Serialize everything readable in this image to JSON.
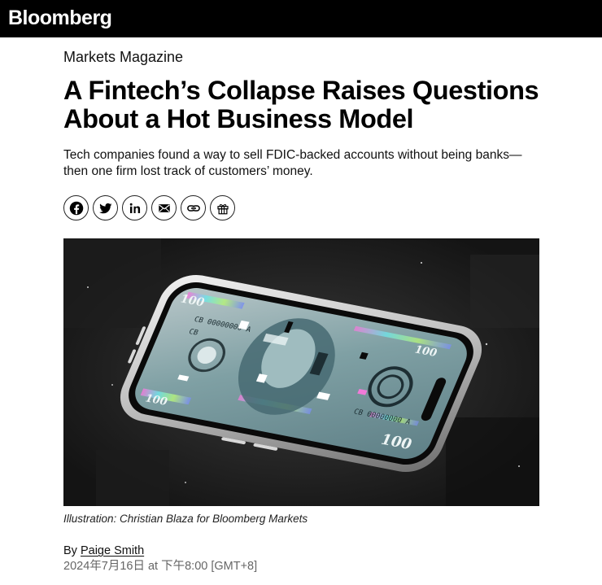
{
  "header": {
    "logo_text": "Bloomberg"
  },
  "article": {
    "kicker": "Markets Magazine",
    "headline_line1": "A Fintech’s Collapse Raises Questions",
    "headline_line2": "About a Hot Business Model",
    "dek_line1": "Tech companies found a way to sell FDIC-backed accounts without being banks—",
    "dek_line2": "then one firm lost track of customers’ money.",
    "caption": "Illustration: Christian Blaza for Bloomberg Markets",
    "byline_prefix": "By",
    "author": "Paige Smith",
    "dateline": "2024年7月16日 at 下午8:00 [GMT+8]"
  },
  "share": {
    "icons": [
      "facebook-icon",
      "twitter-icon",
      "linkedin-icon",
      "email-icon",
      "link-icon",
      "gift-icon"
    ]
  },
  "hero_image": {
    "bill_labels": {
      "corner_top_left": "100",
      "corner_top_right": "100",
      "corner_bottom_left": "100",
      "corner_bottom_right": "100",
      "serial_top": "CB 00000000 A",
      "serial_bottom": "CB 00000000 A",
      "letters": "CB"
    }
  },
  "colors": {
    "topbar": "#000000",
    "text": "#000000",
    "muted": "#666666"
  }
}
